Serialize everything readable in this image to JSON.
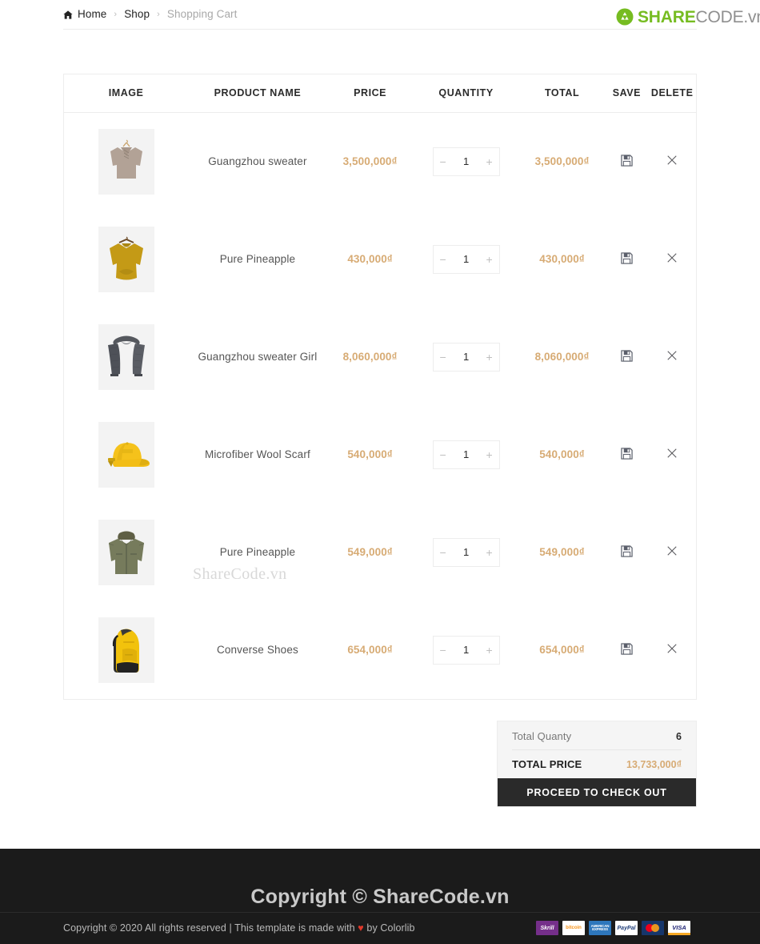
{
  "breadcrumb": {
    "home_icon": "home-icon",
    "home": "Home",
    "separator": "›",
    "shop": "Shop",
    "current": "Shopping Cart"
  },
  "logo": {
    "mark_icon": "sharecode-recycle-icon",
    "text_primary": "SHARE",
    "text_secondary": "CODE.vn",
    "color_primary": "#76bc21",
    "color_secondary": "#8f8f8f"
  },
  "table": {
    "headers": {
      "image": "IMAGE",
      "name": "PRODUCT NAME",
      "price": "PRICE",
      "quantity": "QUANTITY",
      "total": "TOTAL",
      "save": "SAVE",
      "delete": "DELETE"
    },
    "minus_label": "−",
    "plus_label": "+",
    "save_icon": "floppy-disk-save-icon",
    "delete_icon": "close-x-icon",
    "rows": [
      {
        "image_alt": "beige-knit-sweater-on-hanger",
        "name": "Guangzhou sweater",
        "price": "3,500,000₫",
        "quantity": "1",
        "total": "3,500,000₫"
      },
      {
        "image_alt": "mustard-yellow-sweater-on-hanger",
        "name": "Pure Pineapple",
        "price": "430,000₫",
        "quantity": "1",
        "total": "430,000₫"
      },
      {
        "image_alt": "dark-gray-knit-scarf",
        "name": "Guangzhou sweater Girl",
        "price": "8,060,000₫",
        "quantity": "1",
        "total": "8,060,000₫"
      },
      {
        "image_alt": "yellow-baseball-cap",
        "name": "Microfiber Wool Scarf",
        "price": "540,000₫",
        "quantity": "1",
        "total": "540,000₫"
      },
      {
        "image_alt": "olive-green-hooded-jacket",
        "name": "Pure Pineapple",
        "price": "549,000₫",
        "quantity": "1",
        "total": "549,000₫"
      },
      {
        "image_alt": "yellow-black-backpack",
        "name": "Converse Shoes",
        "price": "654,000₫",
        "quantity": "1",
        "total": "654,000₫"
      }
    ]
  },
  "watermark": {
    "middle": "ShareCode.vn",
    "footer": "Copyright © ShareCode.vn"
  },
  "totals": {
    "quantity_label": "Total Quanty",
    "quantity_value": "6",
    "price_label": "TOTAL PRICE",
    "price_value": "13,733,000₫",
    "price_color": "#d7ab74",
    "checkout_label": "PROCEED TO CHECK OUT"
  },
  "footer": {
    "copyright_prefix": "Copyright © 2020 All rights reserved | This template is made with ",
    "heart": "♥",
    "copyright_suffix": " by ",
    "author": "Colorlib",
    "payments": [
      {
        "name": "skrill-badge",
        "label": "Skrill"
      },
      {
        "name": "bitcoin-badge",
        "label": "bitcoin"
      },
      {
        "name": "amex-badge",
        "label": "AMERICAN EXPRESS"
      },
      {
        "name": "paypal-badge",
        "label": "PayPal"
      },
      {
        "name": "mastercard-badge",
        "label": ""
      },
      {
        "name": "visa-badge",
        "label": "VISA"
      }
    ]
  }
}
